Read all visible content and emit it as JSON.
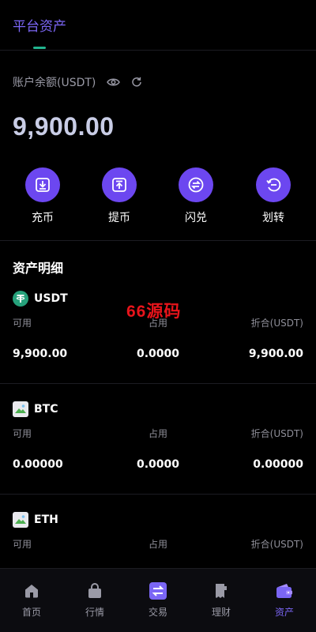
{
  "header": {
    "title": "平台资产"
  },
  "balance": {
    "label": "账户余额(USDT)",
    "value": "9,900.00"
  },
  "actions": [
    {
      "label": "充币",
      "icon": "deposit-icon"
    },
    {
      "label": "提币",
      "icon": "withdraw-icon"
    },
    {
      "label": "闪兑",
      "icon": "swap-icon"
    },
    {
      "label": "划转",
      "icon": "transfer-icon"
    }
  ],
  "assets_section": {
    "title": "资产明细"
  },
  "watermark": "66源码",
  "columns": {
    "available": "可用",
    "occupied": "占用",
    "equivalent": "折合(USDT)"
  },
  "assets": [
    {
      "name": "USDT",
      "available": "9,900.00",
      "occupied": "0.0000",
      "equivalent": "9,900.00"
    },
    {
      "name": "BTC",
      "available": "0.00000",
      "occupied": "0.0000",
      "equivalent": "0.00000"
    },
    {
      "name": "ETH",
      "available": "",
      "occupied": "",
      "equivalent": ""
    }
  ],
  "tabs": [
    {
      "label": "首页",
      "icon": "home-icon",
      "active": false
    },
    {
      "label": "行情",
      "icon": "market-icon",
      "active": false
    },
    {
      "label": "交易",
      "icon": "trade-icon",
      "active": false
    },
    {
      "label": "理财",
      "icon": "finance-icon",
      "active": false
    },
    {
      "label": "资产",
      "icon": "wallet-icon",
      "active": true
    }
  ],
  "colors": {
    "accent": "#6c47f0",
    "active_tab": "#7b66f5",
    "tether": "#26a17b",
    "watermark": "#e8141b"
  }
}
